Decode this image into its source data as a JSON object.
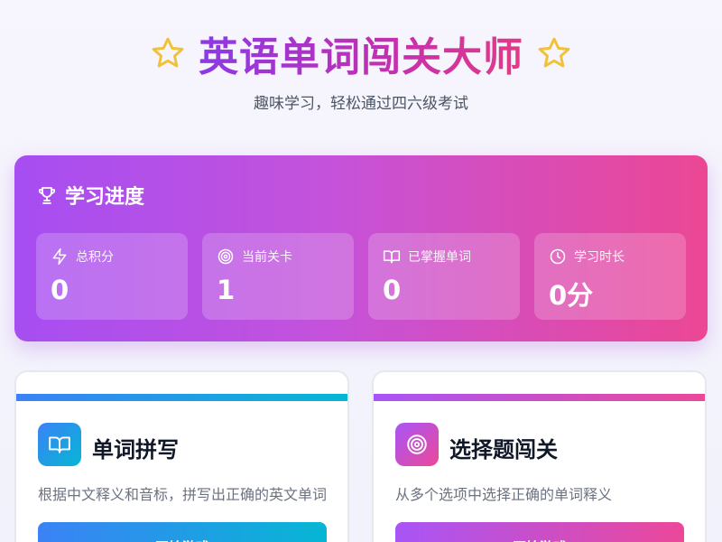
{
  "header": {
    "title": "英语单词闯关大师",
    "subtitle": "趣味学习，轻松通过四六级考试",
    "star_icon": "star-outline",
    "star_color": "#f0c23a"
  },
  "progress": {
    "title": "学习进度",
    "icon": "trophy",
    "stats": [
      {
        "icon": "lightning",
        "label": "总积分",
        "value": "0"
      },
      {
        "icon": "target",
        "label": "当前关卡",
        "value": "1"
      },
      {
        "icon": "book",
        "label": "已掌握单词",
        "value": "0"
      },
      {
        "icon": "clock",
        "label": "学习时长",
        "value": "0分"
      }
    ]
  },
  "games": [
    {
      "icon": "book",
      "title": "单词拼写",
      "description": "根据中文释义和音标，拼写出正确的英文单词",
      "button": "开始游戏",
      "accent": [
        "#3b82f6",
        "#06b6d4"
      ]
    },
    {
      "icon": "target",
      "title": "选择题闯关",
      "description": "从多个选项中选择正确的单词释义",
      "button": "开始游戏",
      "accent": [
        "#a855f7",
        "#ec4899"
      ]
    }
  ]
}
